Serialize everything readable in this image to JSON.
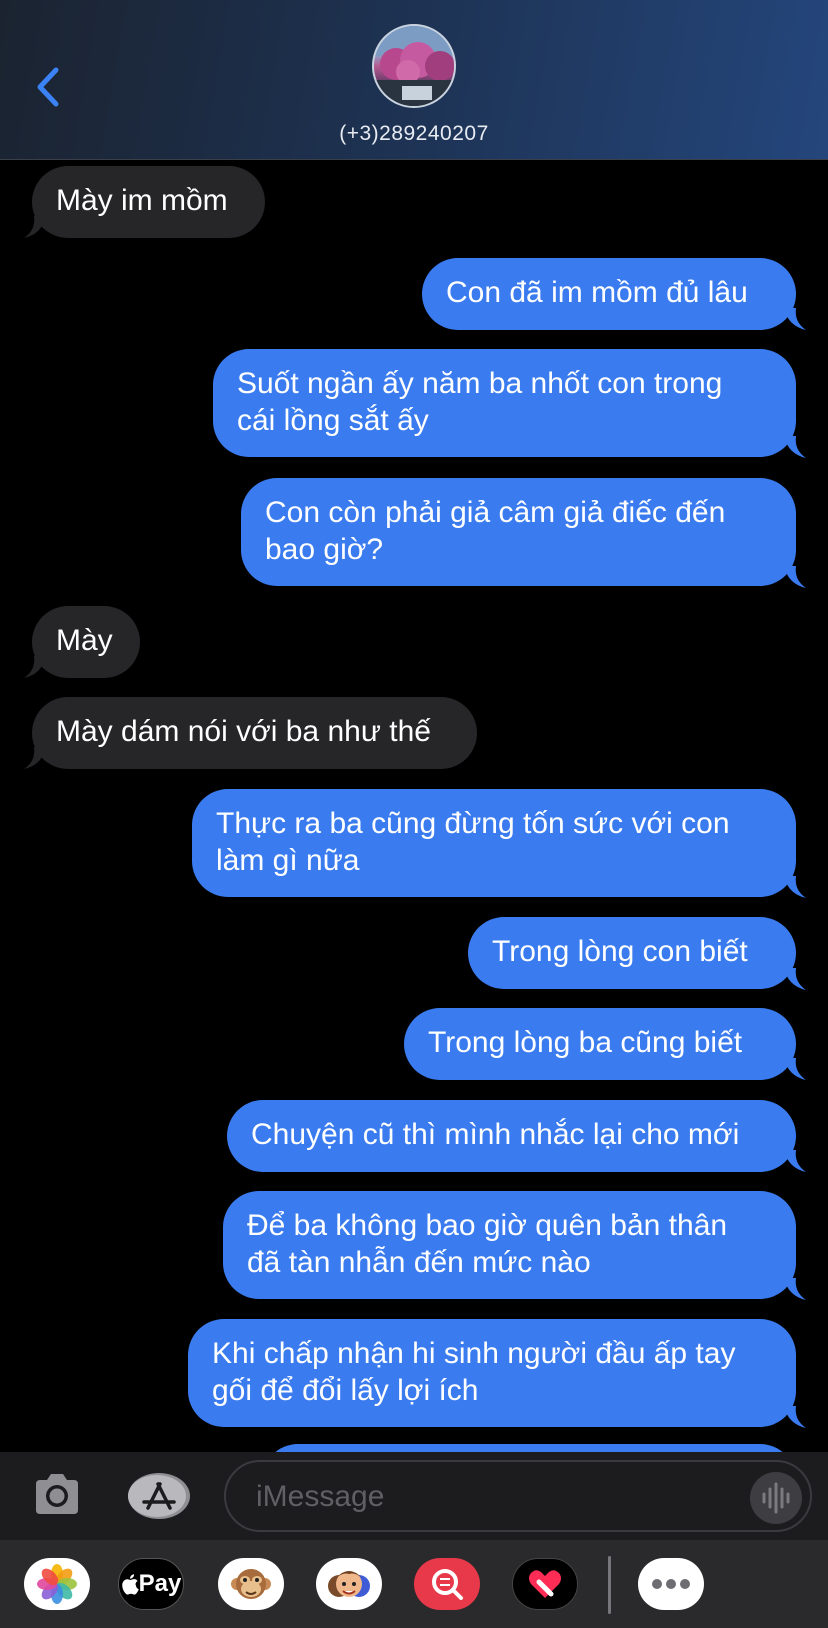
{
  "header": {
    "contact": "(+3)289240207"
  },
  "messages": [
    {
      "side": "in",
      "text": "Mày im mồm"
    },
    {
      "side": "out",
      "text": "Con đã im mồm đủ lâu"
    },
    {
      "side": "out",
      "text": "Suốt ngần ấy năm ba nhốt con trong\ncái lồng sắt ấy"
    },
    {
      "side": "out",
      "text": "Con còn phải giả câm giả điếc đến\nbao giờ?"
    },
    {
      "side": "in",
      "text": "Mày"
    },
    {
      "side": "in",
      "text": "Mày dám nói với ba như thế"
    },
    {
      "side": "out",
      "text": "Thực ra ba cũng đừng tốn sức với con\nlàm gì nữa"
    },
    {
      "side": "out",
      "text": "Trong lòng con biết"
    },
    {
      "side": "out",
      "text": "Trong lòng ba cũng biết"
    },
    {
      "side": "out",
      "text": "Chuyện cũ thì mình nhắc lại cho mới"
    },
    {
      "side": "out",
      "text": "Để ba không bao giờ quên bản thân\nđã tàn nhẫn đến mức nào"
    },
    {
      "side": "out",
      "text": "Khi chấp nhận hi sinh người đầu ấp tay\ngối để đổi lấy lợi ích"
    }
  ],
  "input": {
    "placeholder": "iMessage"
  },
  "drawer": {
    "apple_pay_label": "Pay",
    "apps": [
      "photos-icon",
      "apple-pay-icon",
      "memoji-monkey-icon",
      "memoji-stickers-icon",
      "image-search-icon",
      "digital-touch-icon",
      "more-apps-icon"
    ]
  },
  "colors": {
    "outgoing_bubble": "#3a7cf0",
    "incoming_bubble": "#262629",
    "accent": "#3b82f6"
  }
}
